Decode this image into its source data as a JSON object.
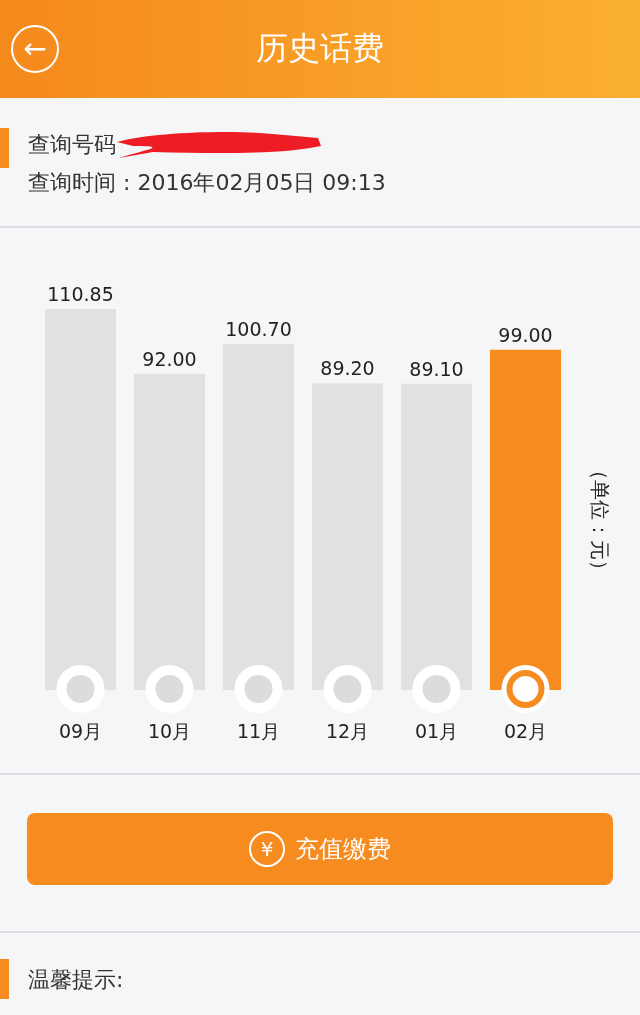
{
  "header": {
    "back_icon": "←",
    "title": "历史话费"
  },
  "query": {
    "number_label": "查询号码",
    "time_label": "查询时间 : 2016年02月05日 09:13"
  },
  "chart": {
    "unit_label": "（单位：元）",
    "bar_states": [
      {
        "selected": false
      },
      {
        "selected": false
      },
      {
        "selected": false
      },
      {
        "selected": false
      },
      {
        "selected": false
      },
      {
        "selected": true
      }
    ],
    "chart_data": {
      "type": "bar",
      "categories": [
        "09月",
        "10月",
        "11月",
        "12月",
        "01月",
        "02月"
      ],
      "values": [
        110.85,
        92.0,
        100.7,
        89.2,
        89.1,
        99.0
      ],
      "value_labels": [
        "110.85",
        "92.00",
        "100.70",
        "89.20",
        "89.10",
        "99.00"
      ],
      "data_labels": true
    }
  },
  "recharge_button": {
    "icon": "¥",
    "label": "充值缴费"
  },
  "tips": {
    "title": "温馨提示:"
  }
}
